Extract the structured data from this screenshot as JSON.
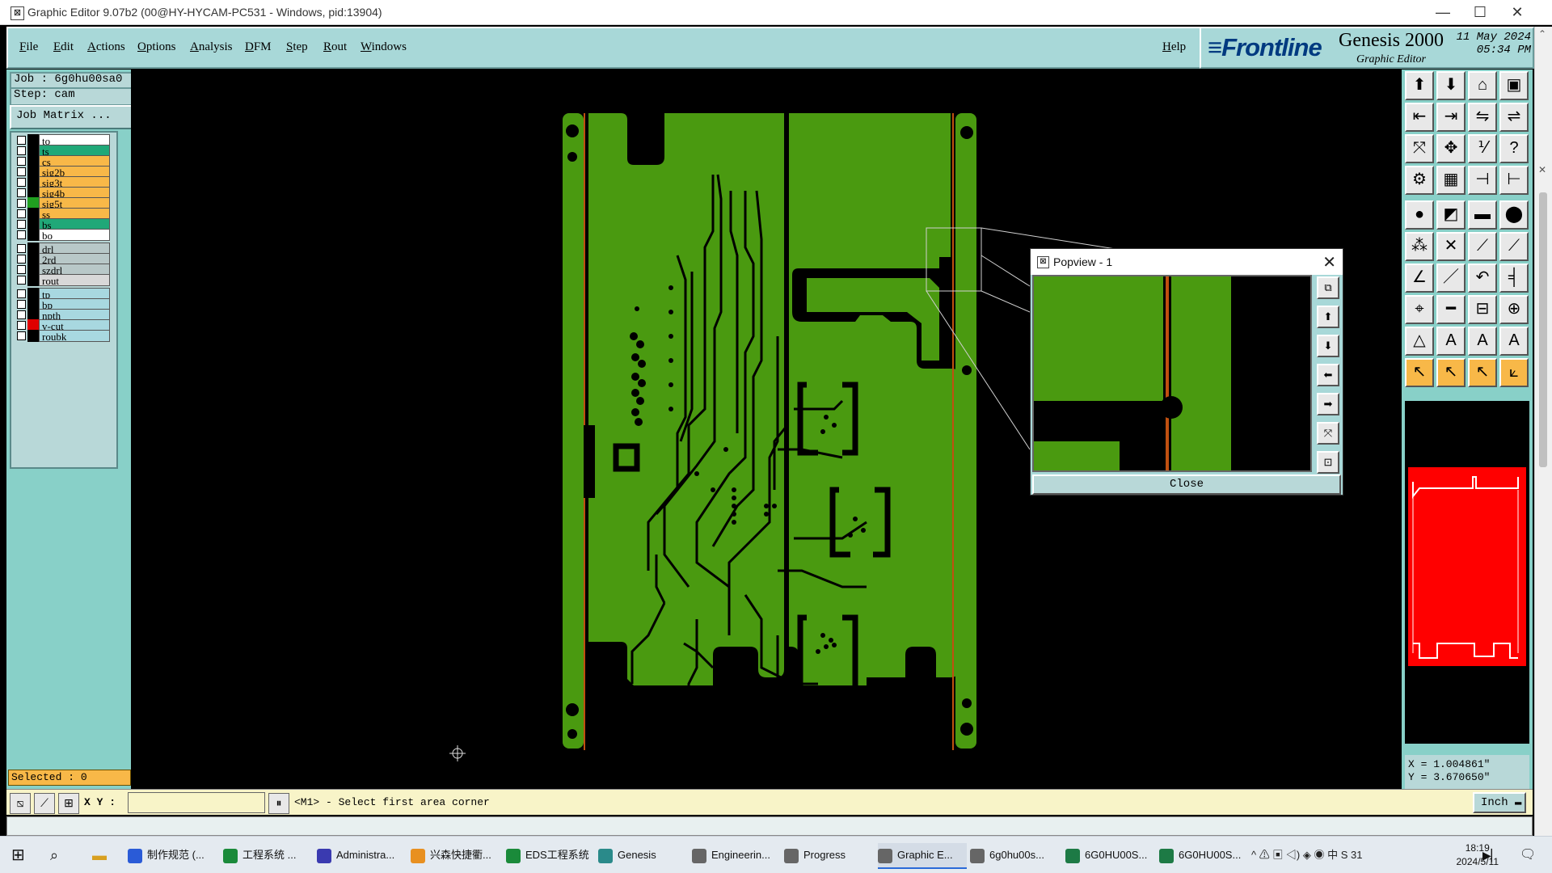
{
  "window": {
    "title": "Graphic Editor 9.07b2 (00@HY-HYCAM-PC531 - Windows, pid:13904)",
    "min": "—",
    "max": "☐",
    "close": "✕"
  },
  "menu": {
    "items": [
      "File",
      "Edit",
      "Actions",
      "Options",
      "Analysis",
      "DFM",
      "Step",
      "Rout",
      "Windows"
    ],
    "help": "Help"
  },
  "brand": {
    "logo": "Frontline",
    "product": "Genesis 2000",
    "subtitle": "Graphic Editor",
    "date": "11 May 2024",
    "time": "05:34 PM"
  },
  "job": {
    "job_label": "Job : 6g0hu00sa0",
    "step_label": "Step: cam",
    "matrix_button": "Job Matrix ..."
  },
  "layers": {
    "group1": [
      {
        "name": "to",
        "color": "#ffffff",
        "swatch": "#000000"
      },
      {
        "name": "ts",
        "color": "#20a878",
        "swatch": "#000000"
      },
      {
        "name": "cs",
        "color": "#f8b848",
        "swatch": "#000000"
      },
      {
        "name": "sig2b",
        "color": "#f8b848",
        "swatch": "#000000"
      },
      {
        "name": "sig3t",
        "color": "#f8b848",
        "swatch": "#000000"
      },
      {
        "name": "sig4b",
        "color": "#f8b848",
        "swatch": "#000000"
      },
      {
        "name": "sig5t",
        "color": "#f8b848",
        "swatch": "#20a020"
      },
      {
        "name": "ss",
        "color": "#f8b848",
        "swatch": "#000000"
      },
      {
        "name": "bs",
        "color": "#20a878",
        "swatch": "#000000"
      },
      {
        "name": "bo",
        "color": "#ffffff",
        "swatch": "#000000"
      }
    ],
    "group2": [
      {
        "name": "drl",
        "color": "#b8c8c8",
        "swatch": "#000000"
      },
      {
        "name": "2rd",
        "color": "#b8c8c8",
        "swatch": "#000000"
      },
      {
        "name": "szdrl",
        "color": "#b8c8c8",
        "swatch": "#000000"
      },
      {
        "name": "rout",
        "color": "#d8d8d8",
        "swatch": "#000000"
      }
    ],
    "group3": [
      {
        "name": "tp",
        "color": "#a8d8e0",
        "swatch": "#000000"
      },
      {
        "name": "bp",
        "color": "#a8d8e0",
        "swatch": "#000000"
      },
      {
        "name": "npth",
        "color": "#a8d8e0",
        "swatch": "#000000"
      },
      {
        "name": "v-cut",
        "color": "#a8d8e0",
        "swatch": "#e00000"
      },
      {
        "name": "roubk",
        "color": "#a8d8e0",
        "swatch": "#000000"
      }
    ]
  },
  "selected": "Selected : 0",
  "status": {
    "xy_label": "X Y :",
    "xy_value": "",
    "prompt": "<M1> - Select first area corner",
    "units": "Inch"
  },
  "coords": {
    "x": "X = 1.004861\"",
    "y": "Y = 3.670650\""
  },
  "popview": {
    "title": "Popview - 1",
    "close_label": "Close"
  },
  "taskbar": {
    "items": [
      {
        "label": "制作规范 (...",
        "icon": "word-icon",
        "color": "#2a5bd7"
      },
      {
        "label": "工程系统 ...",
        "icon": "p-app-icon",
        "color": "#1a8a3a"
      },
      {
        "label": "Administra...",
        "icon": "floppy-icon",
        "color": "#3a3ab0"
      },
      {
        "label": "兴森快捷衢...",
        "icon": "browser-icon",
        "color": "#e89020"
      },
      {
        "label": "EDS工程系统",
        "icon": "p-app-icon",
        "color": "#1a8a3a"
      },
      {
        "label": "Genesis",
        "icon": "genesis-icon",
        "color": "#2a8a8a"
      },
      {
        "label": "Engineerin...",
        "icon": "x-window-icon",
        "color": "#666666"
      },
      {
        "label": "Progress",
        "icon": "x-window-icon",
        "color": "#666666"
      },
      {
        "label": "Graphic E...",
        "icon": "x-window-icon",
        "color": "#666666"
      },
      {
        "label": "6g0hu00s...",
        "icon": "x-window-icon",
        "color": "#666666"
      },
      {
        "label": "6G0HU00S...",
        "icon": "excel-icon",
        "color": "#1d7a45"
      },
      {
        "label": "6G0HU00S...",
        "icon": "excel-icon",
        "color": "#1d7a45"
      }
    ],
    "tray": "^  ⚠  ▣  ◁)  ◈  ◉  中  S  31",
    "time": "18:19",
    "date": "2024/5/11",
    "ime": "中 °, ♪ ▦ ✉ ✂ ⛭"
  }
}
